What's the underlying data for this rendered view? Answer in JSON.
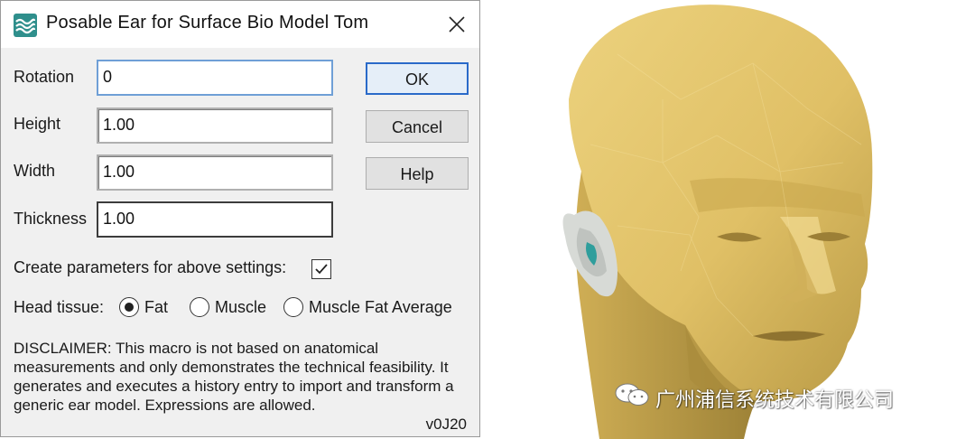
{
  "dialog": {
    "title": "Posable Ear for Surface Bio Model Tom",
    "fields": {
      "rotation": {
        "label": "Rotation",
        "value": "0"
      },
      "height": {
        "label": "Height",
        "value": "1.00"
      },
      "width": {
        "label": "Width",
        "value": "1.00"
      },
      "thickness": {
        "label": "Thickness",
        "value": "1.00"
      }
    },
    "buttons": {
      "ok": "OK",
      "cancel": "Cancel",
      "help": "Help"
    },
    "create_params": {
      "label": "Create parameters for above settings:",
      "checked": true
    },
    "head_tissue": {
      "label": "Head tissue:",
      "options": [
        "Fat",
        "Muscle",
        "Muscle Fat Average"
      ],
      "selected": "Fat"
    },
    "disclaimer": "DISCLAIMER: This macro is not based on anatomical measurements and only demonstrates the technical feasibility. It generates and executes a history entry to import and transform a generic ear model. Expressions are allowed.",
    "version": "v0J20"
  },
  "watermark": {
    "text": "广州浦信系统技术有限公司"
  },
  "colors": {
    "app_icon": "#2f8f8c",
    "default_button_border": "#2a6ac9",
    "head_skin": "#e3c56e",
    "ear": "#d7dad6",
    "ear_canal": "#2f9e9c"
  },
  "icons": {
    "app": "wave-logo-icon",
    "close": "close-icon",
    "check": "checkmark-icon",
    "watermark": "wechat-icon"
  }
}
